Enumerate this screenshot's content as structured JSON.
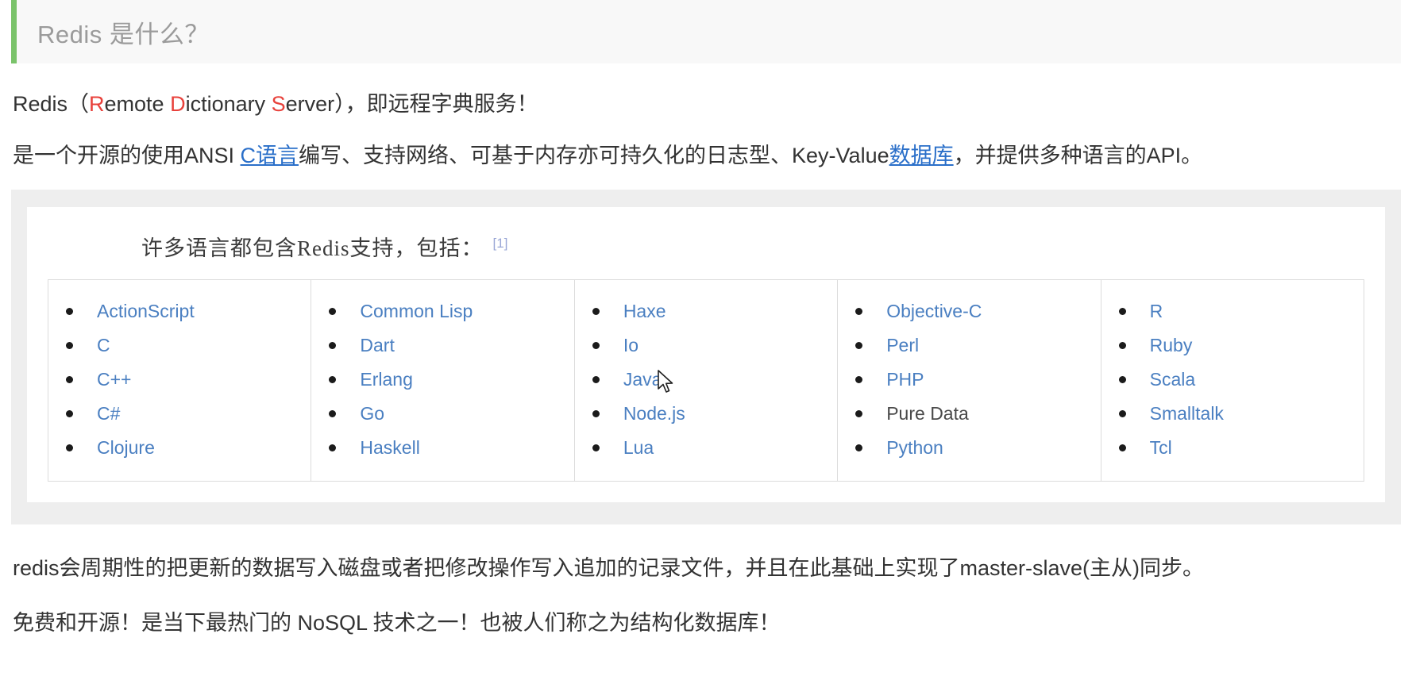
{
  "heading": {
    "title": "Redis 是什么？",
    "accent_color": "#7ac36a",
    "background_color": "#f8f8f8"
  },
  "paragraphs": {
    "intro": {
      "prefix": "Redis（",
      "r1": "R",
      "rest1": "emote ",
      "r2": "D",
      "rest2": "ictionary ",
      "r3": "S",
      "rest3": "erver",
      "suffix": "），即远程字典服务！",
      "highlight_color": "#e8413b"
    },
    "description": {
      "part1": "是一个开源的使用ANSI ",
      "link1": "C语言",
      "part2": "编写、支持网络、可基于内存亦可持久化的日志型、Key-Value",
      "link2": "数据库",
      "part3": "，并提供多种语言的API。",
      "link_color": "#2a6fc9"
    },
    "persistence": "redis会周期性的把更新的数据写入磁盘或者把修改操作写入追加的记录文件，并且在此基础上实现了master-slave(主从)同步。",
    "opensource": "免费和开源！是当下最热门的 NoSQL 技术之一！也被人们称之为结构化数据库！"
  },
  "figure": {
    "caption": "许多语言都包含Redis支持，包括：",
    "footnote": "[1]",
    "footnote_color": "#9aa7d6",
    "columns": [
      {
        "items": [
          {
            "label": "ActionScript",
            "is_link": true
          },
          {
            "label": "C",
            "is_link": true
          },
          {
            "label": "C++",
            "is_link": true
          },
          {
            "label": "C#",
            "is_link": true
          },
          {
            "label": "Clojure",
            "is_link": true
          }
        ]
      },
      {
        "items": [
          {
            "label": "Common Lisp",
            "is_link": true
          },
          {
            "label": "Dart",
            "is_link": true
          },
          {
            "label": "Erlang",
            "is_link": true
          },
          {
            "label": "Go",
            "is_link": true
          },
          {
            "label": "Haskell",
            "is_link": true
          }
        ]
      },
      {
        "items": [
          {
            "label": "Haxe",
            "is_link": true
          },
          {
            "label": "Io",
            "is_link": true
          },
          {
            "label": "Java",
            "is_link": true
          },
          {
            "label": "Node.js",
            "is_link": true
          },
          {
            "label": "Lua",
            "is_link": true
          }
        ]
      },
      {
        "items": [
          {
            "label": "Objective-C",
            "is_link": true
          },
          {
            "label": "Perl",
            "is_link": true
          },
          {
            "label": "PHP",
            "is_link": true
          },
          {
            "label": "Pure Data",
            "is_link": false
          },
          {
            "label": "Python",
            "is_link": true
          }
        ]
      },
      {
        "items": [
          {
            "label": "R",
            "is_link": true
          },
          {
            "label": "Ruby",
            "is_link": true
          },
          {
            "label": "Scala",
            "is_link": true
          },
          {
            "label": "Smalltalk",
            "is_link": true
          },
          {
            "label": "Tcl",
            "is_link": true
          }
        ]
      }
    ]
  },
  "cursor": {
    "icon": "mouse-pointer"
  }
}
